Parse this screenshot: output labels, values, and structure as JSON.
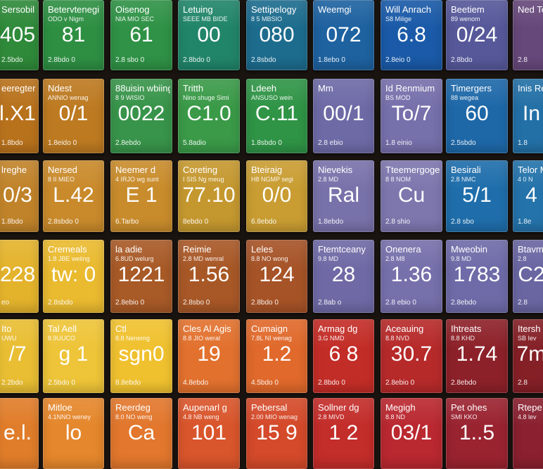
{
  "tiles": [
    [
      {
        "name": "Sersobil",
        "sub": "",
        "symbol": "405",
        "footer": "2.5bdo",
        "color": "#2f8a3a"
      },
      {
        "name": "Betervtenegi",
        "sub": "ODO v Nigm",
        "symbol": "81",
        "footer": "2.8bdo 0",
        "color": "#2e8f43"
      },
      {
        "name": "Oisenog",
        "sub": "NIA MIO SEC",
        "symbol": "61",
        "footer": "2.8 sbo 0",
        "color": "#2f9246"
      },
      {
        "name": "Letuing",
        "sub": "SEEE MB BIDE",
        "symbol": "00",
        "footer": "2.8bdo 0",
        "color": "#21856a"
      },
      {
        "name": "Settipelogy",
        "sub": "8 5 MBSIO",
        "symbol": "080",
        "footer": "2.8sbdo",
        "color": "#1d6c8e"
      },
      {
        "name": "Weemgi",
        "sub": "",
        "symbol": "072",
        "footer": "1.8ebo 0",
        "color": "#1e62a0"
      },
      {
        "name": "Will Anrach",
        "sub": "S8 Milige",
        "symbol": "6.8",
        "footer": "2.8eio 0",
        "color": "#1a5aa8"
      },
      {
        "name": "Beetiem",
        "sub": "89 wenom",
        "symbol": "0/24",
        "footer": "2.8bdo",
        "color": "#56589a"
      },
      {
        "name": "Ned To",
        "sub": "",
        "symbol": "",
        "footer": "2.8",
        "color": "#66487a"
      }
    ],
    [
      {
        "name": "eeregter",
        "sub": "",
        "symbol": "l.X1",
        "footer": "1.8bdo",
        "color": "#b8721c"
      },
      {
        "name": "Ndest",
        "sub": "ANNIO wenag",
        "symbol": "0/1",
        "footer": "1.8eido 0",
        "color": "#bd7a21"
      },
      {
        "name": "88uisin wbiing",
        "sub": "8 9 WISIO",
        "symbol": "0022",
        "footer": "2.8ebdo",
        "color": "#38944a"
      },
      {
        "name": "Tritth",
        "sub": "Nino shuge Simi",
        "symbol": "C1.0",
        "footer": "5.8adio",
        "color": "#3a9a48"
      },
      {
        "name": "Ldeeh",
        "sub": "ANSUSO wein",
        "symbol": "C.11",
        "footer": "1.8sbdo 0",
        "color": "#2f9446"
      },
      {
        "name": "Mm",
        "sub": "",
        "symbol": "00/1",
        "footer": "2.8 ebio",
        "color": "#6d6aa6"
      },
      {
        "name": "Id Renmium",
        "sub": "BS MOD",
        "symbol": "To/7",
        "footer": "1.8 einio",
        "color": "#7670ab"
      },
      {
        "name": "Timergers",
        "sub": "88 wegea",
        "symbol": "60",
        "footer": "2.5sbdo",
        "color": "#1e68a8"
      },
      {
        "name": "Inis Re",
        "sub": "",
        "symbol": "In",
        "footer": "1.8",
        "color": "#2370a6"
      }
    ],
    [
      {
        "name": "lreghe",
        "sub": "",
        "symbol": "0/3",
        "footer": "1.8bdo",
        "color": "#c0832a"
      },
      {
        "name": "Nersed",
        "sub": "8 II MIEO",
        "symbol": "L.42",
        "footer": "2.8sbdo 0",
        "color": "#c98a2b"
      },
      {
        "name": "Neemer d",
        "sub": "4 IRJO wg sunt",
        "symbol": "E 1",
        "footer": "6.Tarbo",
        "color": "#c98c2c"
      },
      {
        "name": "Coreting",
        "sub": "I SIS Ng meug",
        "symbol": "77.10",
        "footer": "8ebdo 0",
        "color": "#c5982f"
      },
      {
        "name": "Bteiraig",
        "sub": "H8 NGMP segi",
        "symbol": "0/0",
        "footer": "6.8ebdo",
        "color": "#c99d32"
      },
      {
        "name": "Nievekis",
        "sub": "2.8 MD",
        "symbol": "Ral",
        "footer": "1.8ebdo",
        "color": "#7872aa"
      },
      {
        "name": "Tteemergoge",
        "sub": "8 8 NOM",
        "symbol": "Cu",
        "footer": "2.8 shio",
        "color": "#7d77ae"
      },
      {
        "name": "Besirali",
        "sub": "2.8 NMC",
        "symbol": "5/1",
        "footer": "2.8 sbo",
        "color": "#1f6eab"
      },
      {
        "name": "Telor M",
        "sub": "4 0 N",
        "symbol": "4",
        "footer": "1.8e",
        "color": "#2473aa"
      }
    ],
    [
      {
        "name": "",
        "sub": "",
        "symbol": "228",
        "footer": "eo",
        "color": "#e4b32c"
      },
      {
        "name": "Cremeals",
        "sub": "1.8 JBE weiing",
        "symbol": "tw: 0",
        "footer": "2.8sbdo",
        "color": "#eaba2f"
      },
      {
        "name": "la adie",
        "sub": "6.8UD welurg",
        "symbol": "1221",
        "footer": "2.8ebio 0",
        "color": "#a85a27"
      },
      {
        "name": "Reimie",
        "sub": "2.8 MD wenral",
        "symbol": "1.56",
        "footer": "2.8sbo 0",
        "color": "#a85827"
      },
      {
        "name": "Leles",
        "sub": "8.8 NO wong",
        "symbol": "124",
        "footer": "2.8bdo 0",
        "color": "#a65327"
      },
      {
        "name": "Ftemtceany",
        "sub": "9.8 MD",
        "symbol": "28",
        "footer": "2.8ab o",
        "color": "#6f6aa5"
      },
      {
        "name": "Onenera",
        "sub": "2.8 M8",
        "symbol": "1.36",
        "footer": "2.8 ebio 0",
        "color": "#7670ab"
      },
      {
        "name": "Mweobin",
        "sub": "9.8 MD",
        "symbol": "1783",
        "footer": "2.8ebdo",
        "color": "#6e6ba8"
      },
      {
        "name": "Btavm",
        "sub": "2.8",
        "symbol": "C2",
        "footer": "2.8",
        "color": "#6a66a2"
      }
    ],
    [
      {
        "name": "Ito",
        "sub": "UWU",
        "symbol": "/7",
        "footer": "2.2bdo",
        "color": "#e9be33"
      },
      {
        "name": "Tal Aell",
        "sub": "8.9UUCO",
        "symbol": "g 1",
        "footer": "2.5bdo 0",
        "color": "#eec438"
      },
      {
        "name": "Ctl",
        "sub": "8.8 Nenemg",
        "symbol": "sgn0",
        "footer": "8.8ebdo",
        "color": "#f0c12f"
      },
      {
        "name": "Cles Al Agis",
        "sub": "8.8 JIO weral",
        "symbol": "19",
        "footer": "4.8ebdo",
        "color": "#e2712e"
      },
      {
        "name": "Cumaign",
        "sub": "7.8L NI wenag",
        "symbol": "1.2",
        "footer": "4.5bdo 0",
        "color": "#e0692b"
      },
      {
        "name": "Armag dg",
        "sub": "3.G NMD",
        "symbol": "6 8",
        "footer": "2.8bdo 0",
        "color": "#c32d27"
      },
      {
        "name": "Aceauing",
        "sub": "8.8 NVD",
        "symbol": "30.7",
        "footer": "2.8ebio 0",
        "color": "#b72a2a"
      },
      {
        "name": "Ihtreats",
        "sub": "8.8 KHD",
        "symbol": "1.74",
        "footer": "2.8ebdo",
        "color": "#8d2129"
      },
      {
        "name": "Itersh",
        "sub": "SB Iev",
        "symbol": "7m",
        "footer": "2.8",
        "color": "#852027"
      }
    ],
    [
      {
        "name": "",
        "sub": "",
        "symbol": "e.l.",
        "footer": "",
        "color": "#e07d2a"
      },
      {
        "name": "Mitloe",
        "sub": "4.1NNO weney",
        "symbol": "lo",
        "footer": "",
        "color": "#e5872c"
      },
      {
        "name": "Reerdeg",
        "sub": "8.0 NO weng",
        "symbol": "Ca",
        "footer": "",
        "color": "#e2772d"
      },
      {
        "name": "Aupenarl g",
        "sub": "4.8 NB weng",
        "symbol": "101",
        "footer": "",
        "color": "#d9552b"
      },
      {
        "name": "Pebersal",
        "sub": "2.00 MIO wenag",
        "symbol": "15 9",
        "footer": "",
        "color": "#d44a2a"
      },
      {
        "name": "Sollner dg",
        "sub": "2.8 MIVD",
        "symbol": "1 2",
        "footer": "",
        "color": "#c32d2a"
      },
      {
        "name": "Megigh",
        "sub": "8.8 ND",
        "symbol": "03/1",
        "footer": "",
        "color": "#ba2830"
      },
      {
        "name": "Pet ohes",
        "sub": "SMI KKO",
        "symbol": "1..5",
        "footer": "",
        "color": "#9a2330"
      },
      {
        "name": "Rtepe",
        "sub": "4.8 lev",
        "symbol": "",
        "footer": "",
        "color": "#8a2030"
      }
    ]
  ]
}
